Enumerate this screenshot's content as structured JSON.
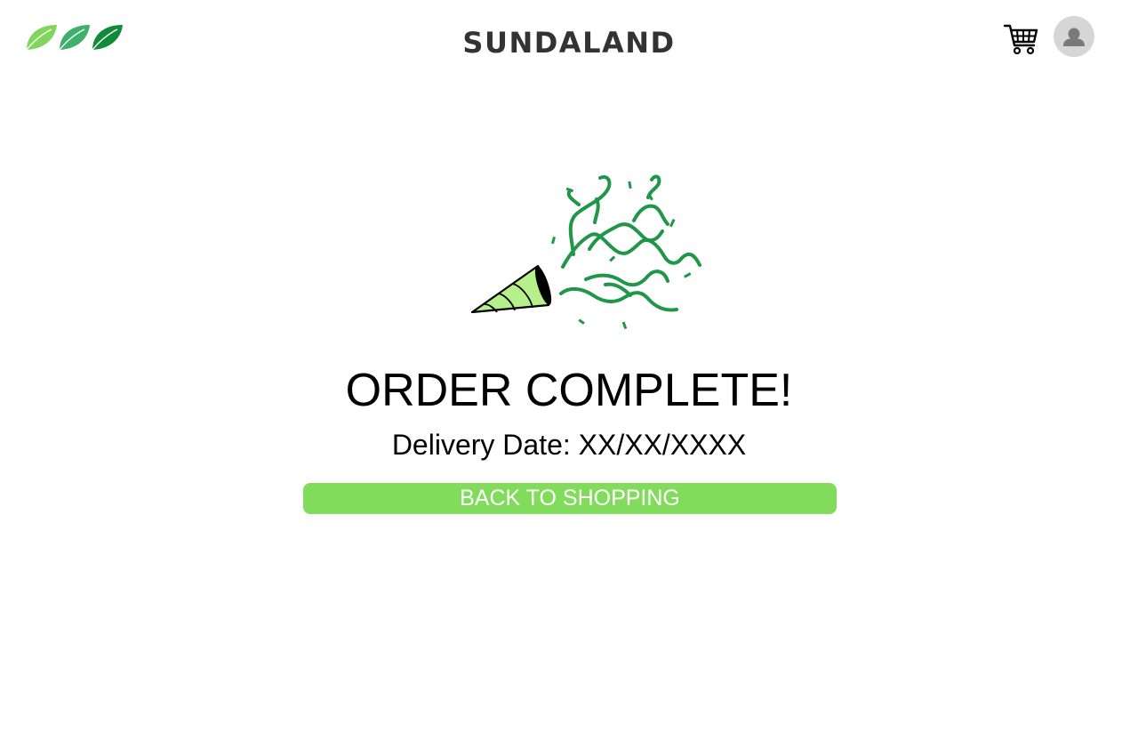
{
  "header": {
    "brand_name": "SUNDALAND",
    "logo_icon": "leaf-logo-icon",
    "cart_icon": "shopping-cart-icon",
    "avatar_icon": "user-avatar-icon"
  },
  "main": {
    "illustration_icon": "party-popper-icon",
    "title": "ORDER COMPLETE!",
    "delivery_label": "Delivery Date:",
    "delivery_value": "XX/XX/XXXX",
    "back_button_label": "BACK TO SHOPPING"
  },
  "colors": {
    "brand_text": "#333333",
    "button_green": "#80dc5a",
    "leaf_light": "#7fd65a",
    "leaf_mid": "#3faf6c",
    "leaf_dark": "#138a3a",
    "confetti_green": "#1f9648",
    "cone_fill": "#b5f08a",
    "avatar_bg": "#d6d6d6",
    "avatar_fg": "#7a7a7a"
  }
}
